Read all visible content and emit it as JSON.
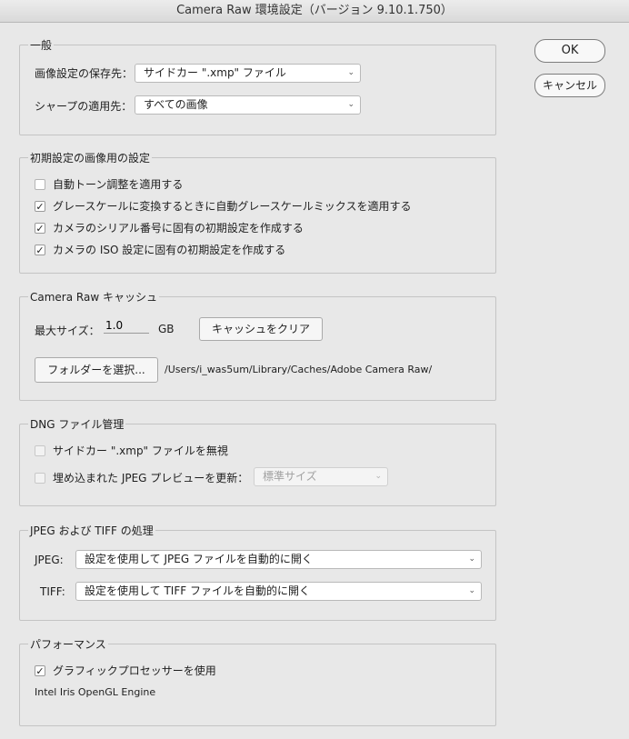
{
  "window_title": "Camera Raw 環境設定（バージョン 9.10.1.750）",
  "buttons": {
    "ok": "OK",
    "cancel": "キャンセル"
  },
  "general": {
    "title": "一般",
    "save_label": "画像設定の保存先：",
    "save_value": "サイドカー \".xmp\" ファイル",
    "sharpen_label": "シャープの適用先：",
    "sharpen_value": "すべての画像"
  },
  "defaults": {
    "title": "初期設定の画像用の設定",
    "items": [
      {
        "label": "自動トーン調整を適用する",
        "checked": false
      },
      {
        "label": "グレースケールに変換するときに自動グレースケールミックスを適用する",
        "checked": true
      },
      {
        "label": "カメラのシリアル番号に固有の初期設定を作成する",
        "checked": true
      },
      {
        "label": "カメラの ISO 設定に固有の初期設定を作成する",
        "checked": true
      }
    ]
  },
  "cache": {
    "title": "Camera Raw キャッシュ",
    "max_size_label": "最大サイズ：",
    "max_size_value": "1.0",
    "unit": "GB",
    "clear_button": "キャッシュをクリア",
    "folder_button": "フォルダーを選択...",
    "path": "/Users/i_was5um/Library/Caches/Adobe Camera Raw/"
  },
  "dng": {
    "title": "DNG ファイル管理",
    "ignore_sidecar": "サイドカー \".xmp\" ファイルを無視",
    "update_preview": "埋め込まれた JPEG プレビューを更新：",
    "preview_size": "標準サイズ"
  },
  "jpeg_tiff": {
    "title": "JPEG および TIFF の処理",
    "jpeg_label": "JPEG:",
    "jpeg_value": "設定を使用して JPEG ファイルを自動的に開く",
    "tiff_label": "TIFF:",
    "tiff_value": "設定を使用して TIFF ファイルを自動的に開く"
  },
  "performance": {
    "title": "パフォーマンス",
    "gpu_label": "グラフィックプロセッサーを使用",
    "gpu_checked": true,
    "gpu_name": "Intel Iris OpenGL Engine"
  }
}
